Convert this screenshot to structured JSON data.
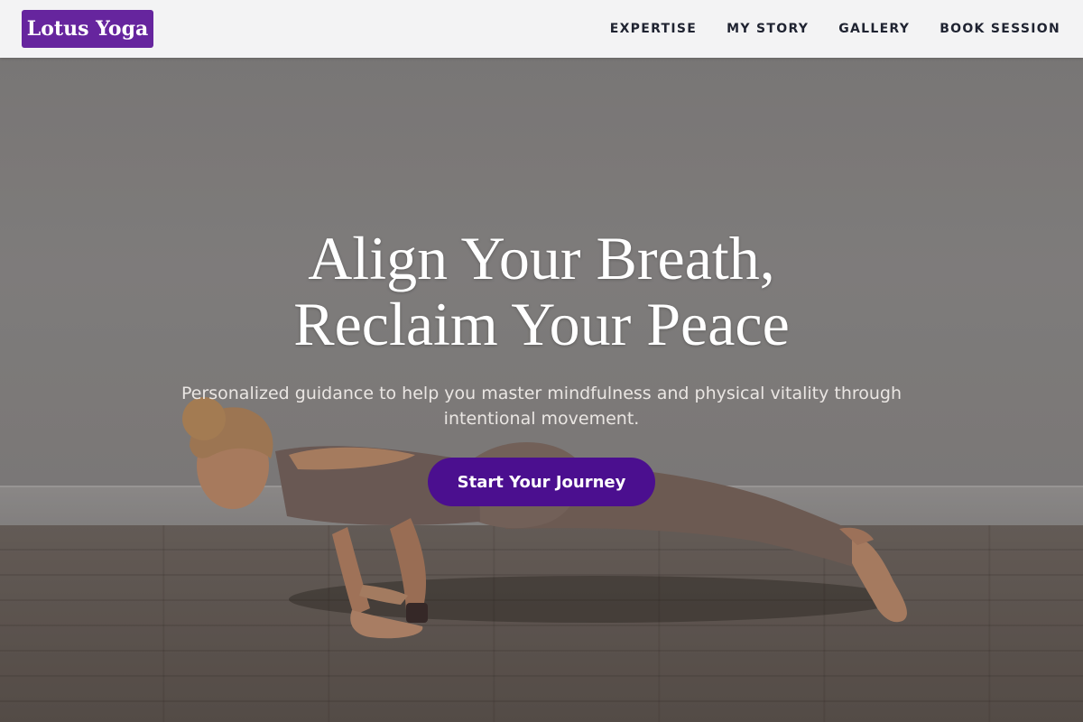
{
  "header": {
    "brand": "Lotus Yoga",
    "nav": [
      {
        "label": "EXPERTISE"
      },
      {
        "label": "MY STORY"
      },
      {
        "label": "GALLERY"
      },
      {
        "label": "BOOK SESSION"
      }
    ]
  },
  "hero": {
    "title_line1": "Align Your Breath,",
    "title_line2": "Reclaim Your Peace",
    "subtitle": "Personalized guidance to help you master mindfulness and physical vitality through intentional movement.",
    "cta_label": "Start Your Journey"
  },
  "colors": {
    "brand_background": "#66259e",
    "cta_background": "#4b0f8f",
    "header_background": "#f3f3f4",
    "nav_text": "#1f2331"
  }
}
